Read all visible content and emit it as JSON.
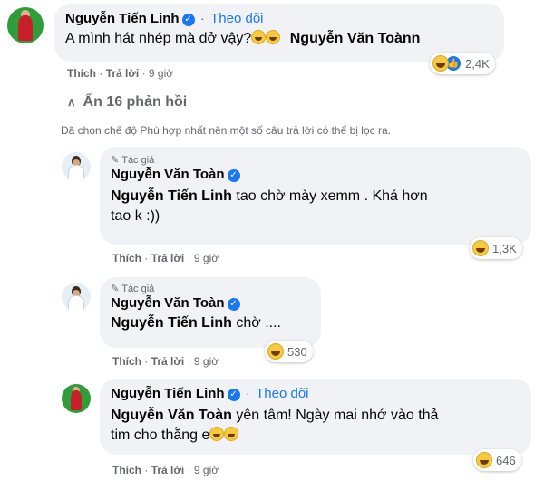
{
  "comment1": {
    "name": "Nguyễn Tiến Linh",
    "follow": "Theo dõi",
    "text": "A mình hát nhép mà dở vậy?",
    "mention": "Nguyễn Văn Toànn",
    "reaction_count": "2,4K",
    "like": "Thích",
    "reply": "Trả lời",
    "time": "9 giờ"
  },
  "hide_replies": "Ẩn 16 phản hồi",
  "filter_note": "Đã chọn chế độ Phù hợp nhất nên một số câu trả lời có thể bị lọc ra.",
  "reply1": {
    "badge": "Tác giả",
    "name": "Nguyễn Văn Toàn",
    "mention": "Nguyễn Tiến Linh",
    "text_line1": " tao chờ mày xemm . Khá hơn",
    "text_line2": "tao k :))",
    "reaction_count": "1,3K",
    "like": "Thích",
    "reply": "Trả lời",
    "time": "9 giờ"
  },
  "reply2": {
    "badge": "Tác giả",
    "name": "Nguyễn Văn Toàn",
    "mention": "Nguyễn Tiến Linh",
    "text": " chờ ....",
    "reaction_count": "530",
    "like": "Thích",
    "reply": "Trả lời",
    "time": "9 giờ"
  },
  "reply3": {
    "name": "Nguyễn Tiến Linh",
    "follow": "Theo dõi",
    "mention": "Nguyễn Văn Toàn",
    "text_line1": " yên tâm! Ngày mai nhớ vào thả",
    "text_line2": "tim cho thằng e",
    "reaction_count": "646",
    "like": "Thích",
    "reply": "Trả lời",
    "time": "9 giờ"
  },
  "colors": {
    "link": "#1877f2",
    "bubble": "#f0f2f5",
    "muted": "#65676b"
  }
}
